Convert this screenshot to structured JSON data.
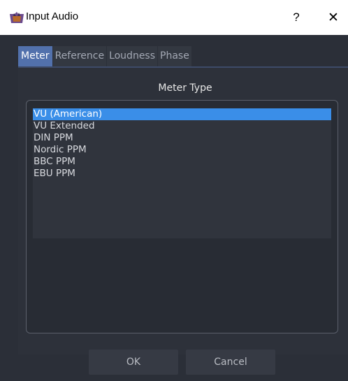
{
  "window": {
    "title": "Input Audio",
    "help_label": "?",
    "close_label": "✕"
  },
  "tabs": [
    {
      "label": "Meter",
      "active": true
    },
    {
      "label": "Reference",
      "active": false
    },
    {
      "label": "Loudness",
      "active": false
    },
    {
      "label": "Phase",
      "active": false
    }
  ],
  "meter_type": {
    "heading": "Meter Type",
    "selected": "VU (American)",
    "options": [
      "VU (American)",
      "VU Extended",
      "DIN PPM",
      "Nordic PPM",
      "BBC PPM",
      "EBU PPM"
    ]
  },
  "buttons": {
    "ok_label": "OK",
    "cancel_label": "Cancel"
  },
  "colors": {
    "accent_tab": "#5271ac",
    "selection": "#3a8ee8",
    "background": "#2b2f38"
  }
}
